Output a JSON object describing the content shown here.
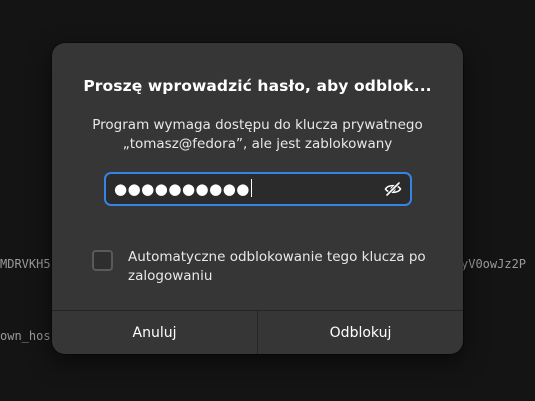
{
  "background": {
    "fragments": [
      "MDRVKH5",
      "own_hos",
      "yV0owJz2P"
    ]
  },
  "dialog": {
    "title": "Proszę wprowadzić hasło, aby odblok...",
    "message_line1": "Program wymaga dostępu do klucza prywatnego",
    "message_line2": "„tomasz@fedora”, ale jest zablokowany",
    "password": {
      "masked_value": "●●●●●●●●●●",
      "toggle_icon": "eye-slash-icon",
      "accent_color": "#3584e4"
    },
    "auto_unlock": {
      "checked": false,
      "label": "Automatyczne odblokowanie tego klucza po zalogowaniu"
    },
    "buttons": {
      "cancel_label": "Anuluj",
      "unlock_label": "Odblokuj"
    }
  }
}
